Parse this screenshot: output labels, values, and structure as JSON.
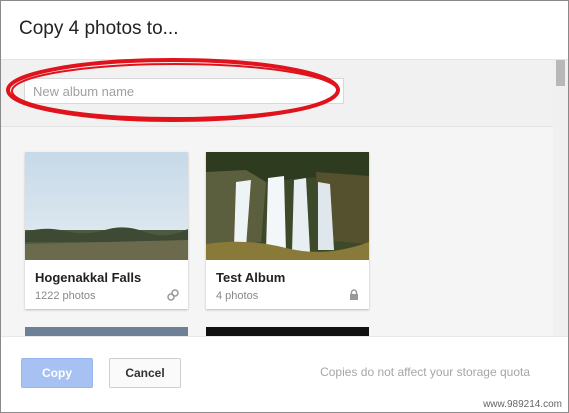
{
  "dialog": {
    "title": "Copy 4 photos to..."
  },
  "search": {
    "placeholder": "New album name",
    "value": ""
  },
  "albums": [
    {
      "name": "Hogenakkal Falls",
      "count": "1222 photos",
      "badge_icon": "link-icon"
    },
    {
      "name": "Test Album",
      "count": "4 photos",
      "badge_icon": "lock-icon"
    }
  ],
  "footer": {
    "copy_label": "Copy",
    "cancel_label": "Cancel",
    "note": "Copies do not affect your storage quota"
  },
  "watermark": "www.989214.com",
  "colors": {
    "highlight": "#e0131c",
    "copy_button": "#a7c2f2"
  }
}
